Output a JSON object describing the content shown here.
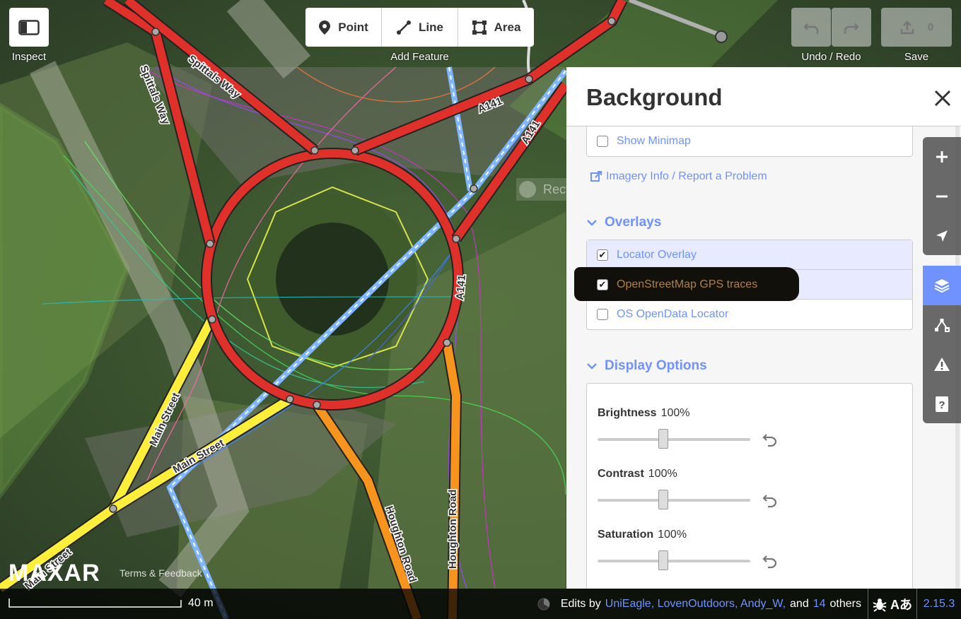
{
  "toolbar": {
    "inspect_label": "Inspect",
    "add_feature_label": "Add Feature",
    "point_label": "Point",
    "line_label": "Line",
    "area_label": "Area",
    "undo_redo_label": "Undo / Redo",
    "save_label": "Save",
    "save_count": "0"
  },
  "map": {
    "road_labels": [
      "Spittals Way",
      "Spittals Way",
      "A141",
      "A141",
      "A141",
      "Main Street",
      "Main Street",
      "Main Street",
      "Houghton Road",
      "Houghton Road"
    ],
    "ghost_label": "Rectangular Ship",
    "imagery_brand": "MAXAR",
    "terms_link": "Terms & Feedback",
    "scale_label": "40 m"
  },
  "panel": {
    "title": "Background",
    "minimap_label": "Show Minimap",
    "imagery_info_link": "Imagery Info / Report a Problem",
    "overlays_heading": "Overlays",
    "overlays": [
      {
        "label": "Locator Overlay",
        "checked": true
      },
      {
        "label": "OpenStreetMap GPS traces",
        "checked": true
      },
      {
        "label": "OS OpenData Locator",
        "checked": false
      }
    ],
    "display_heading": "Display Options",
    "sliders": [
      {
        "label": "Brightness",
        "value": "100%",
        "level": 0.5
      },
      {
        "label": "Contrast",
        "value": "100%",
        "level": 0.5
      },
      {
        "label": "Saturation",
        "value": "100%",
        "level": 0.5
      }
    ]
  },
  "footer": {
    "edits_by": "Edits by",
    "users": "UniEagle, LovenOutdoors, Andy_W,",
    "and": "and",
    "others_count": "14",
    "others": "others",
    "lang_glyph": "Aあ",
    "version": "2.15.3"
  },
  "colors": {
    "accent": "#7092ff",
    "primary_road": "#e0302a",
    "secondary_road": "#f7941d",
    "tertiary_road": "#ffef3a"
  }
}
